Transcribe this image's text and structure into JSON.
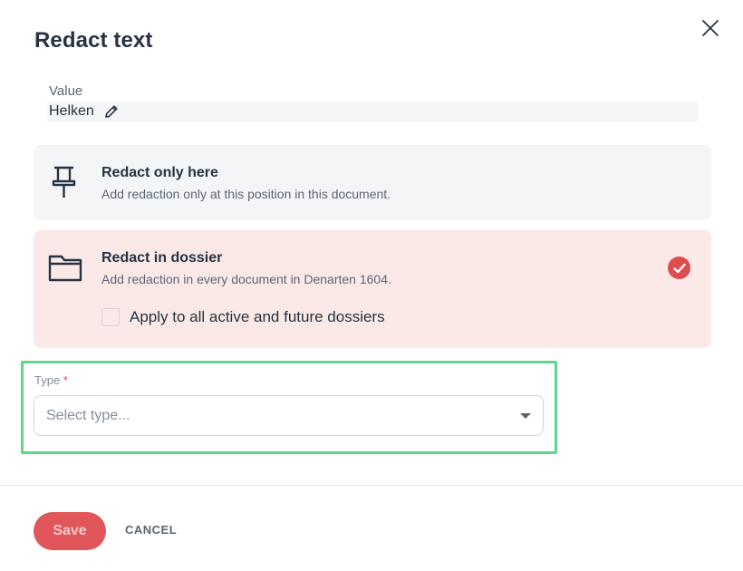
{
  "dialog": {
    "title": "Redact text",
    "close_icon": "close-icon"
  },
  "value": {
    "label": "Value",
    "text": "Helken",
    "edit_icon": "pencil-icon"
  },
  "options": [
    {
      "icon": "pushpin-icon",
      "title": "Redact only here",
      "description": "Add redaction only at this position in this document.",
      "selected": false
    },
    {
      "icon": "folder-icon",
      "title": "Redact in dossier",
      "description": "Add redaction in every document in Denarten 1604.",
      "selected": true,
      "sub_option": {
        "label": "Apply to all active and future dossiers",
        "checked": false
      }
    }
  ],
  "type_field": {
    "label": "Type",
    "required_marker": "*",
    "placeholder": "Select type..."
  },
  "footer": {
    "save_label": "Save",
    "cancel_label": "CANCEL"
  },
  "colors": {
    "accent": "#dd4d50",
    "selected_bg": "#fbe9e8",
    "option_bg": "#f4f5f7",
    "highlight": "#5fd68a"
  }
}
